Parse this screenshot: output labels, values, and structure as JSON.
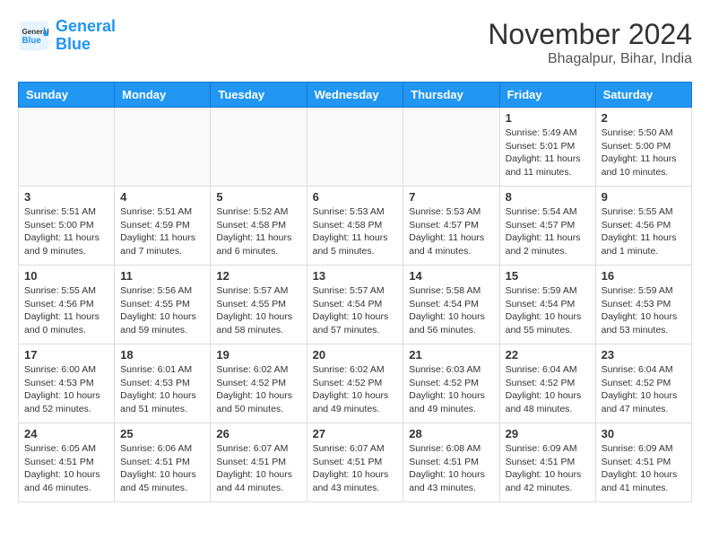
{
  "header": {
    "logo_line1": "General",
    "logo_line2": "Blue",
    "month_title": "November 2024",
    "location": "Bhagalpur, Bihar, India"
  },
  "weekdays": [
    "Sunday",
    "Monday",
    "Tuesday",
    "Wednesday",
    "Thursday",
    "Friday",
    "Saturday"
  ],
  "weeks": [
    [
      {
        "day": "",
        "info": ""
      },
      {
        "day": "",
        "info": ""
      },
      {
        "day": "",
        "info": ""
      },
      {
        "day": "",
        "info": ""
      },
      {
        "day": "",
        "info": ""
      },
      {
        "day": "1",
        "info": "Sunrise: 5:49 AM\nSunset: 5:01 PM\nDaylight: 11 hours and 11 minutes."
      },
      {
        "day": "2",
        "info": "Sunrise: 5:50 AM\nSunset: 5:00 PM\nDaylight: 11 hours and 10 minutes."
      }
    ],
    [
      {
        "day": "3",
        "info": "Sunrise: 5:51 AM\nSunset: 5:00 PM\nDaylight: 11 hours and 9 minutes."
      },
      {
        "day": "4",
        "info": "Sunrise: 5:51 AM\nSunset: 4:59 PM\nDaylight: 11 hours and 7 minutes."
      },
      {
        "day": "5",
        "info": "Sunrise: 5:52 AM\nSunset: 4:58 PM\nDaylight: 11 hours and 6 minutes."
      },
      {
        "day": "6",
        "info": "Sunrise: 5:53 AM\nSunset: 4:58 PM\nDaylight: 11 hours and 5 minutes."
      },
      {
        "day": "7",
        "info": "Sunrise: 5:53 AM\nSunset: 4:57 PM\nDaylight: 11 hours and 4 minutes."
      },
      {
        "day": "8",
        "info": "Sunrise: 5:54 AM\nSunset: 4:57 PM\nDaylight: 11 hours and 2 minutes."
      },
      {
        "day": "9",
        "info": "Sunrise: 5:55 AM\nSunset: 4:56 PM\nDaylight: 11 hours and 1 minute."
      }
    ],
    [
      {
        "day": "10",
        "info": "Sunrise: 5:55 AM\nSunset: 4:56 PM\nDaylight: 11 hours and 0 minutes."
      },
      {
        "day": "11",
        "info": "Sunrise: 5:56 AM\nSunset: 4:55 PM\nDaylight: 10 hours and 59 minutes."
      },
      {
        "day": "12",
        "info": "Sunrise: 5:57 AM\nSunset: 4:55 PM\nDaylight: 10 hours and 58 minutes."
      },
      {
        "day": "13",
        "info": "Sunrise: 5:57 AM\nSunset: 4:54 PM\nDaylight: 10 hours and 57 minutes."
      },
      {
        "day": "14",
        "info": "Sunrise: 5:58 AM\nSunset: 4:54 PM\nDaylight: 10 hours and 56 minutes."
      },
      {
        "day": "15",
        "info": "Sunrise: 5:59 AM\nSunset: 4:54 PM\nDaylight: 10 hours and 55 minutes."
      },
      {
        "day": "16",
        "info": "Sunrise: 5:59 AM\nSunset: 4:53 PM\nDaylight: 10 hours and 53 minutes."
      }
    ],
    [
      {
        "day": "17",
        "info": "Sunrise: 6:00 AM\nSunset: 4:53 PM\nDaylight: 10 hours and 52 minutes."
      },
      {
        "day": "18",
        "info": "Sunrise: 6:01 AM\nSunset: 4:53 PM\nDaylight: 10 hours and 51 minutes."
      },
      {
        "day": "19",
        "info": "Sunrise: 6:02 AM\nSunset: 4:52 PM\nDaylight: 10 hours and 50 minutes."
      },
      {
        "day": "20",
        "info": "Sunrise: 6:02 AM\nSunset: 4:52 PM\nDaylight: 10 hours and 49 minutes."
      },
      {
        "day": "21",
        "info": "Sunrise: 6:03 AM\nSunset: 4:52 PM\nDaylight: 10 hours and 49 minutes."
      },
      {
        "day": "22",
        "info": "Sunrise: 6:04 AM\nSunset: 4:52 PM\nDaylight: 10 hours and 48 minutes."
      },
      {
        "day": "23",
        "info": "Sunrise: 6:04 AM\nSunset: 4:52 PM\nDaylight: 10 hours and 47 minutes."
      }
    ],
    [
      {
        "day": "24",
        "info": "Sunrise: 6:05 AM\nSunset: 4:51 PM\nDaylight: 10 hours and 46 minutes."
      },
      {
        "day": "25",
        "info": "Sunrise: 6:06 AM\nSunset: 4:51 PM\nDaylight: 10 hours and 45 minutes."
      },
      {
        "day": "26",
        "info": "Sunrise: 6:07 AM\nSunset: 4:51 PM\nDaylight: 10 hours and 44 minutes."
      },
      {
        "day": "27",
        "info": "Sunrise: 6:07 AM\nSunset: 4:51 PM\nDaylight: 10 hours and 43 minutes."
      },
      {
        "day": "28",
        "info": "Sunrise: 6:08 AM\nSunset: 4:51 PM\nDaylight: 10 hours and 43 minutes."
      },
      {
        "day": "29",
        "info": "Sunrise: 6:09 AM\nSunset: 4:51 PM\nDaylight: 10 hours and 42 minutes."
      },
      {
        "day": "30",
        "info": "Sunrise: 6:09 AM\nSunset: 4:51 PM\nDaylight: 10 hours and 41 minutes."
      }
    ]
  ]
}
